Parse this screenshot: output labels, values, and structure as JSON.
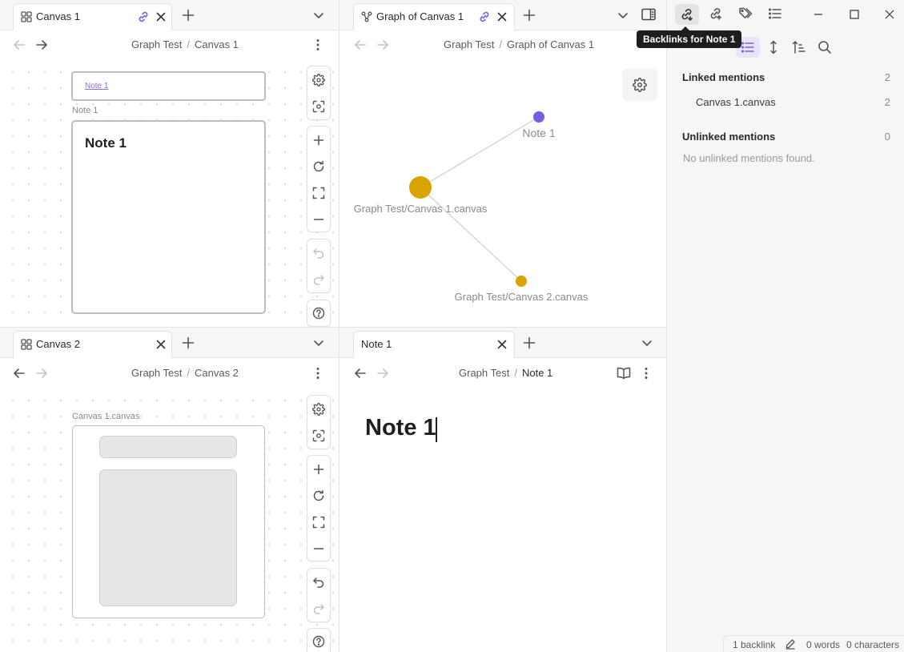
{
  "panes": {
    "top_left": {
      "tab_title": "Canvas 1",
      "breadcrumb": [
        "Graph Test",
        "Canvas 1"
      ],
      "link_card_text": "Note 1",
      "note_card_label": "Note 1",
      "note_card_heading": "Note 1"
    },
    "top_right": {
      "tab_title": "Graph of Canvas 1",
      "breadcrumb": [
        "Graph Test",
        "Graph of Canvas 1"
      ],
      "graph": {
        "nodes": [
          {
            "label": "Note 1",
            "color": "#7b5ce0"
          },
          {
            "label": "Graph Test/Canvas 1.canvas",
            "color": "#d9a300"
          },
          {
            "label": "Graph Test/Canvas 2.canvas",
            "color": "#d9a300"
          }
        ]
      }
    },
    "bottom_left": {
      "tab_title": "Canvas 2",
      "breadcrumb": [
        "Graph Test",
        "Canvas 2"
      ],
      "embed_label": "Canvas 1.canvas"
    },
    "bottom_right": {
      "tab_title": "Note 1",
      "breadcrumb": [
        "Graph Test",
        "Note 1"
      ],
      "note_heading": "Note 1"
    }
  },
  "sidebar": {
    "tooltip": "Backlinks for Note 1",
    "linked_title": "Linked mentions",
    "linked_count": "2",
    "linked_items": [
      {
        "name": "Canvas 1.canvas",
        "count": "2"
      }
    ],
    "unlinked_title": "Unlinked mentions",
    "unlinked_count": "0",
    "unlinked_empty": "No unlinked mentions found."
  },
  "status": {
    "backlinks": "1 backlink",
    "words": "0 words",
    "characters": "0 characters"
  },
  "colors": {
    "accent": "#7b5ce0",
    "canvas_node": "#d9a300"
  }
}
